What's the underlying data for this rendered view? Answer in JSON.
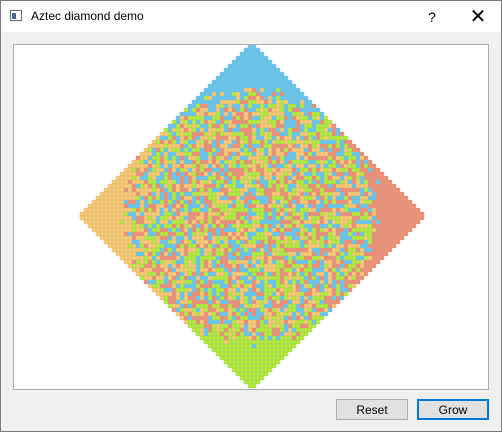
{
  "window": {
    "title": "Aztec diamond demo",
    "help_label": "?",
    "close_label": "✕"
  },
  "icons": {
    "app": "app-window-icon",
    "help": "help-question-icon",
    "close": "close-icon"
  },
  "diamond": {
    "tile_colors": {
      "north": "#5bc8f5",
      "east": "#f28b6e",
      "south": "#aef02c",
      "west": "#ffc966",
      "grid_line": "#b0b0b0"
    }
  },
  "buttons": {
    "reset_label": "Reset",
    "grow_label": "Grow"
  }
}
